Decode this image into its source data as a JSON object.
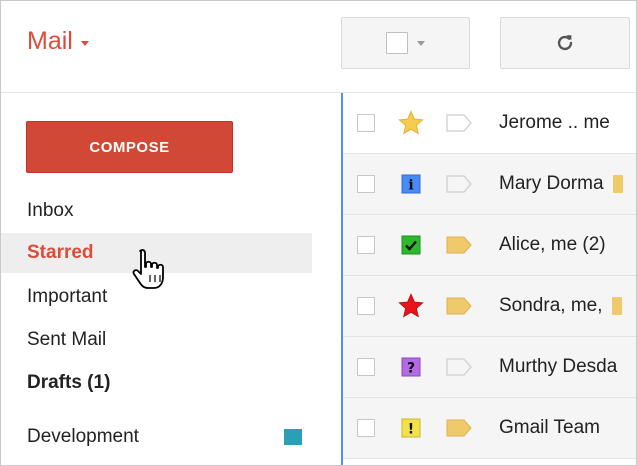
{
  "header": {
    "mail_label": "Mail",
    "select_control": "select-all-checkbox",
    "refresh_icon": "refresh-icon"
  },
  "sidebar": {
    "compose_label": "COMPOSE",
    "items": [
      {
        "label": "Inbox",
        "active": false,
        "bold": false
      },
      {
        "label": "Starred",
        "active": true,
        "bold": false
      },
      {
        "label": "Important",
        "active": false,
        "bold": false
      },
      {
        "label": "Sent Mail",
        "active": false,
        "bold": false
      },
      {
        "label": "Drafts (1)",
        "active": false,
        "bold": true
      },
      {
        "label": "Development",
        "active": false,
        "bold": false,
        "label_color": "#2aa0b7"
      }
    ]
  },
  "messages": [
    {
      "sender": "Jerome .. me",
      "star": "yellow-star-icon",
      "important": false
    },
    {
      "sender": "Mary Dorma",
      "star": "blue-info-icon",
      "important": false
    },
    {
      "sender": "Alice, me (2)",
      "star": "green-check-icon",
      "important": true
    },
    {
      "sender": "Sondra, me,",
      "star": "red-star-icon",
      "important": true
    },
    {
      "sender": "Murthy Desda",
      "star": "purple-question-icon",
      "important": false
    },
    {
      "sender": "Gmail Team",
      "star": "yellow-bang-icon",
      "important": true
    }
  ],
  "colors": {
    "brand_red": "#dd4b39",
    "compose_bg": "#d14836",
    "selection_blue": "#4d90fe",
    "important_yellow": "#f0c96a"
  }
}
